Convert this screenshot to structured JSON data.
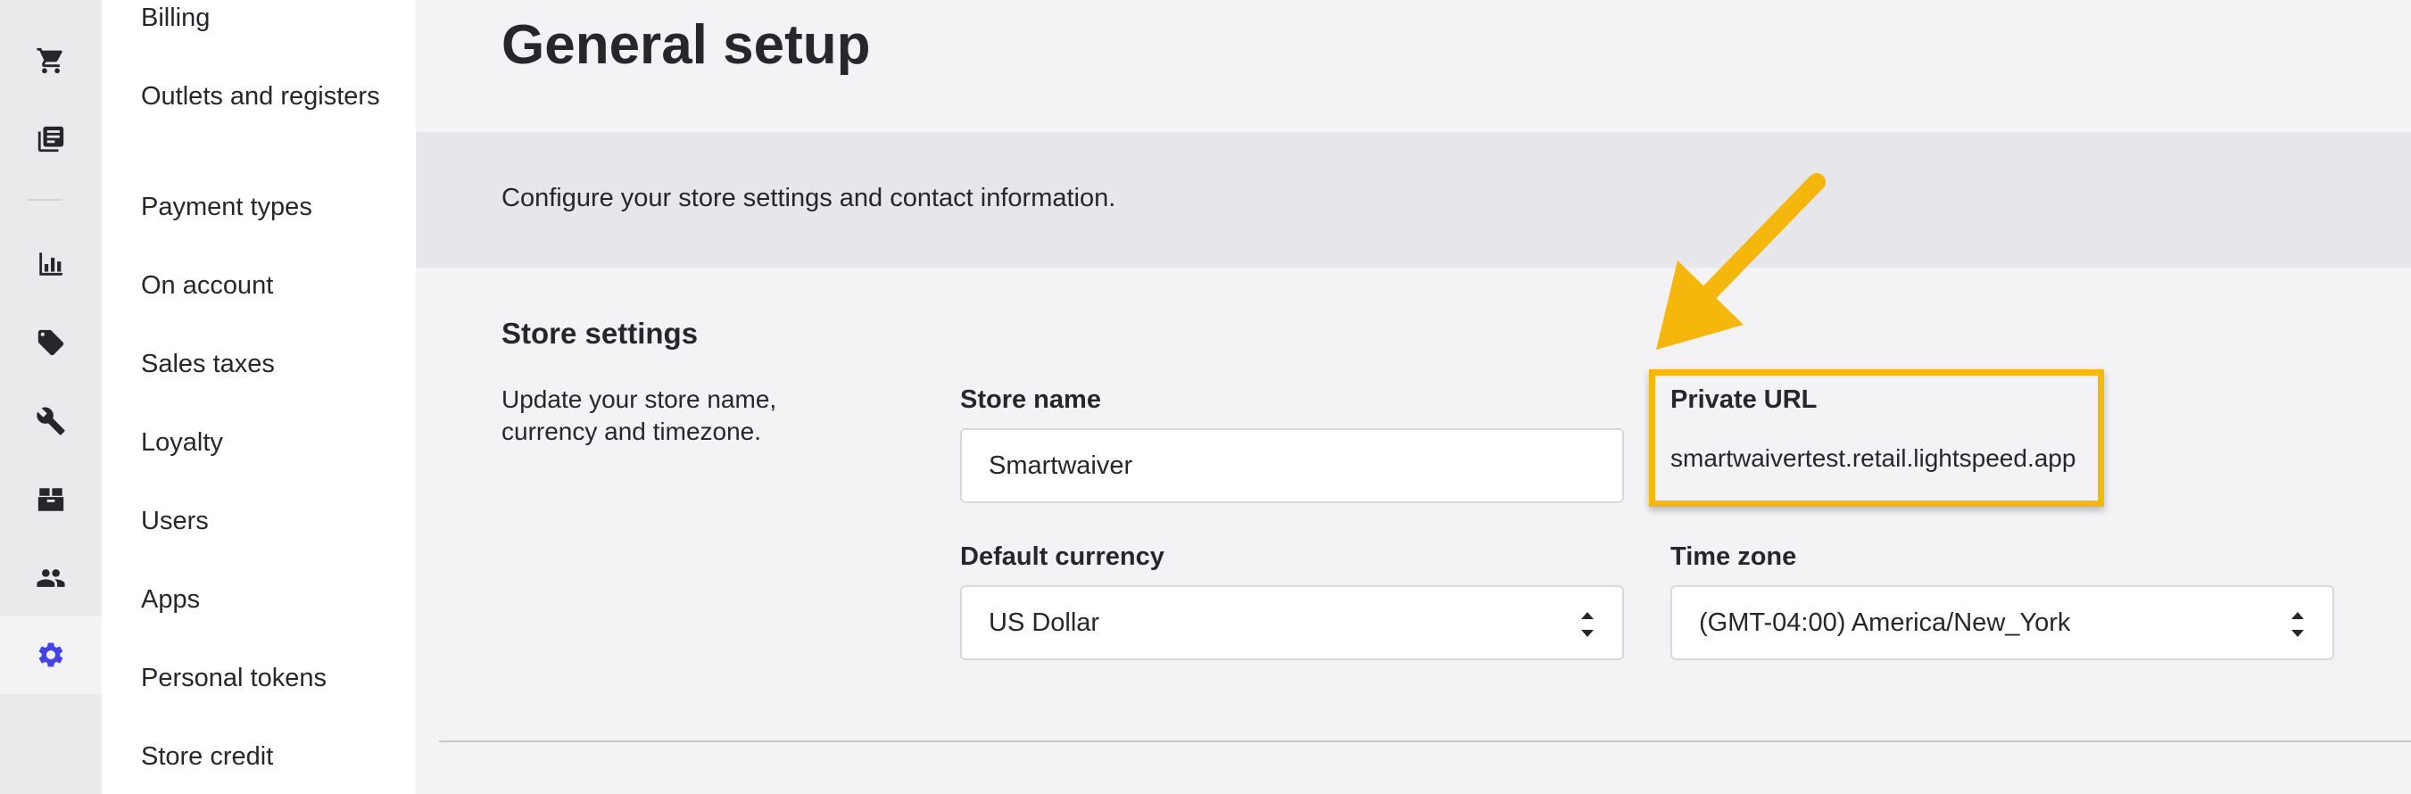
{
  "nav_rail": {
    "icons": [
      "cart-icon",
      "register-icon",
      "reports-icon",
      "tag-icon",
      "wrench-icon",
      "inventory-icon",
      "customers-icon",
      "gear-icon"
    ],
    "active": "gear-icon",
    "active_color": "#4444e6"
  },
  "subnav": {
    "items": [
      {
        "label": "Billing"
      },
      {
        "label": "Outlets and registers"
      },
      {
        "label": "Payment types"
      },
      {
        "label": "On account"
      },
      {
        "label": "Sales taxes"
      },
      {
        "label": "Loyalty"
      },
      {
        "label": "Users"
      },
      {
        "label": "Apps"
      },
      {
        "label": "Personal tokens"
      },
      {
        "label": "Store credit"
      }
    ]
  },
  "page": {
    "title": "General setup",
    "banner_text": "Configure your store settings and contact information."
  },
  "store_settings": {
    "title": "Store settings",
    "description": "Update your store name, currency and timezone.",
    "store_name": {
      "label": "Store name",
      "value": "Smartwaiver"
    },
    "private_url": {
      "label": "Private URL",
      "value": "smartwaivertest.retail.lightspeed.app"
    },
    "default_currency": {
      "label": "Default currency",
      "value": "US Dollar"
    },
    "time_zone": {
      "label": "Time zone",
      "value": "(GMT-04:00) America/New_York"
    }
  },
  "annotation": {
    "highlight_color": "#f6b70c"
  }
}
